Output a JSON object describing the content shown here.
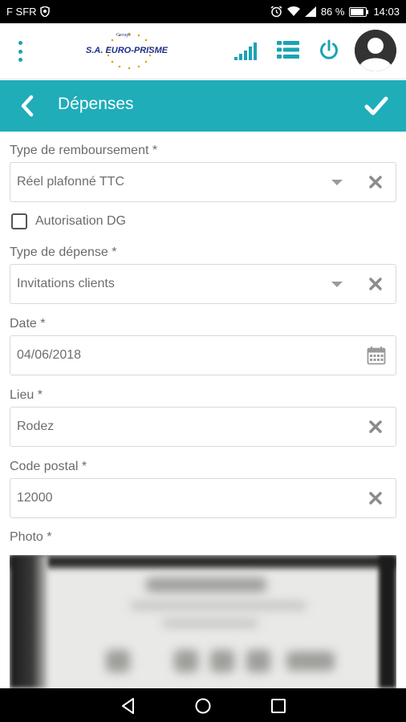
{
  "status_bar": {
    "carrier": "F SFR",
    "battery": "86 %",
    "time": "14:03"
  },
  "app_header": {
    "logo_groupe": "Groupe",
    "logo_brand": "S.A. EURO-PRISME",
    "icons": [
      "menu-kebab-icon",
      "signal-strength-icon",
      "list-icon",
      "power-icon",
      "user-avatar-icon"
    ],
    "accent_color": "#1aa3b3"
  },
  "title_bar": {
    "title": "Dépenses",
    "color": "#1eadb9"
  },
  "form": {
    "type_remboursement": {
      "label": "Type de remboursement *",
      "value": "Réel plafonné TTC"
    },
    "autorisation_dg": {
      "label": "Autorisation DG",
      "checked": false
    },
    "type_depense": {
      "label": "Type de dépense *",
      "value": "Invitations clients"
    },
    "date": {
      "label": "Date *",
      "value": "04/06/2018"
    },
    "lieu": {
      "label": "Lieu *",
      "value": "Rodez"
    },
    "code_postal": {
      "label": "Code postal *",
      "value": "12000"
    },
    "photo": {
      "label": "Photo *"
    }
  }
}
